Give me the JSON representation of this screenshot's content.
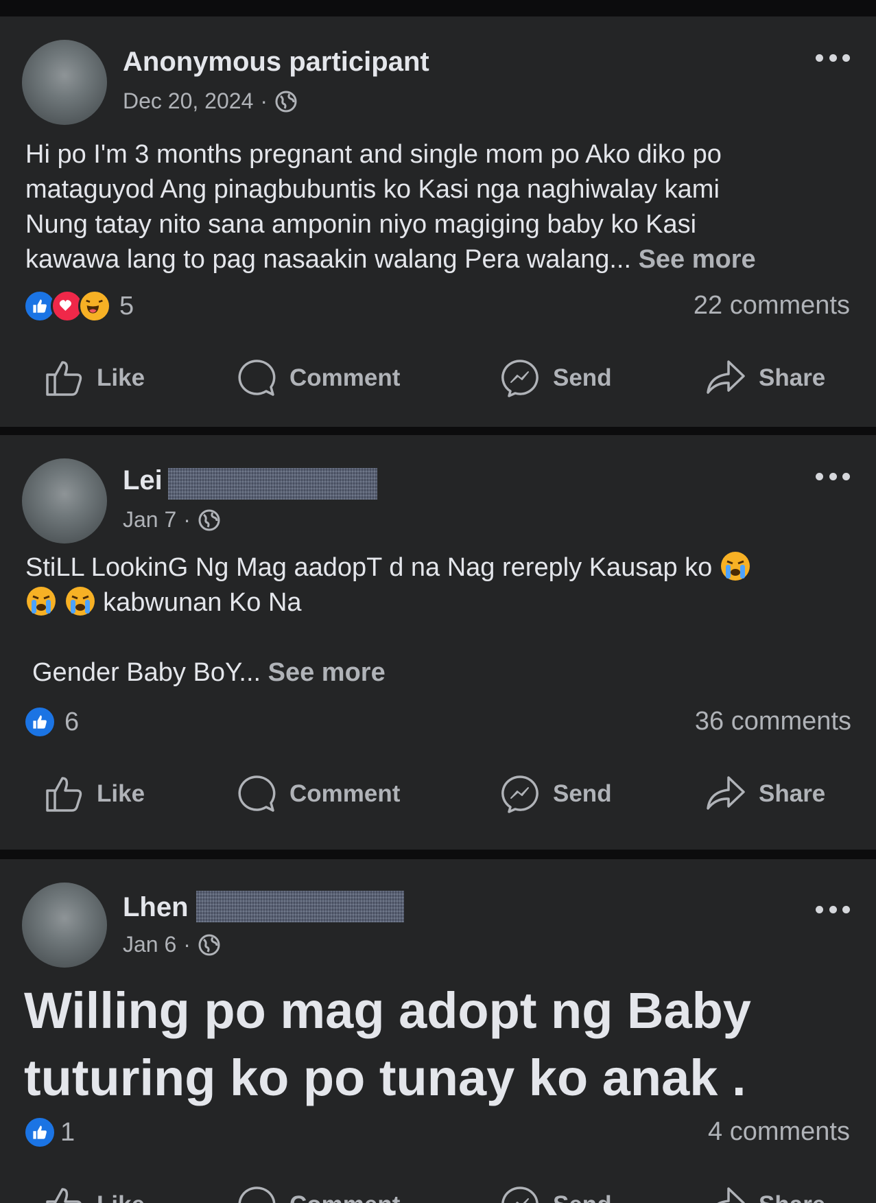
{
  "posts": [
    {
      "author": "Anonymous participant",
      "date": "Dec 20, 2024",
      "text_lines": [
        "Hi po I'm 3 months pregnant and single mom po Ako diko po",
        "mataguyod Ang pinagbubuntis ko Kasi nga naghiwalay kami",
        "Nung tatay nito sana amponin niyo magiging baby ko Kasi",
        "kawawa lang to pag nasaakin walang Pera walang... "
      ],
      "see_more": "See more",
      "reaction_count": "5",
      "reactions": [
        "like",
        "love",
        "haha"
      ],
      "comments": "22 comments"
    },
    {
      "author": "Lei",
      "date": "Jan 7",
      "line1": "StiLL LookinG Ng Mag aadopT  d na Nag rereply Kausap ko",
      "line2": " kabwunan Ko Na",
      "line3": "Gender Baby BoY... ",
      "see_more": "See more",
      "reaction_count": "6",
      "reactions": [
        "like"
      ],
      "comments": "36 comments"
    },
    {
      "author": "Lhen",
      "date": "Jan 6",
      "big_line1": "Willing po mag adopt ng Baby",
      "big_line2": "tuturing ko po tunay ko anak .",
      "reaction_count": "1",
      "reactions": [
        "like"
      ],
      "comments": "4 comments"
    }
  ],
  "actions": {
    "like": "Like",
    "comment": "Comment",
    "send": "Send",
    "share": "Share"
  },
  "meta_separator": "·"
}
